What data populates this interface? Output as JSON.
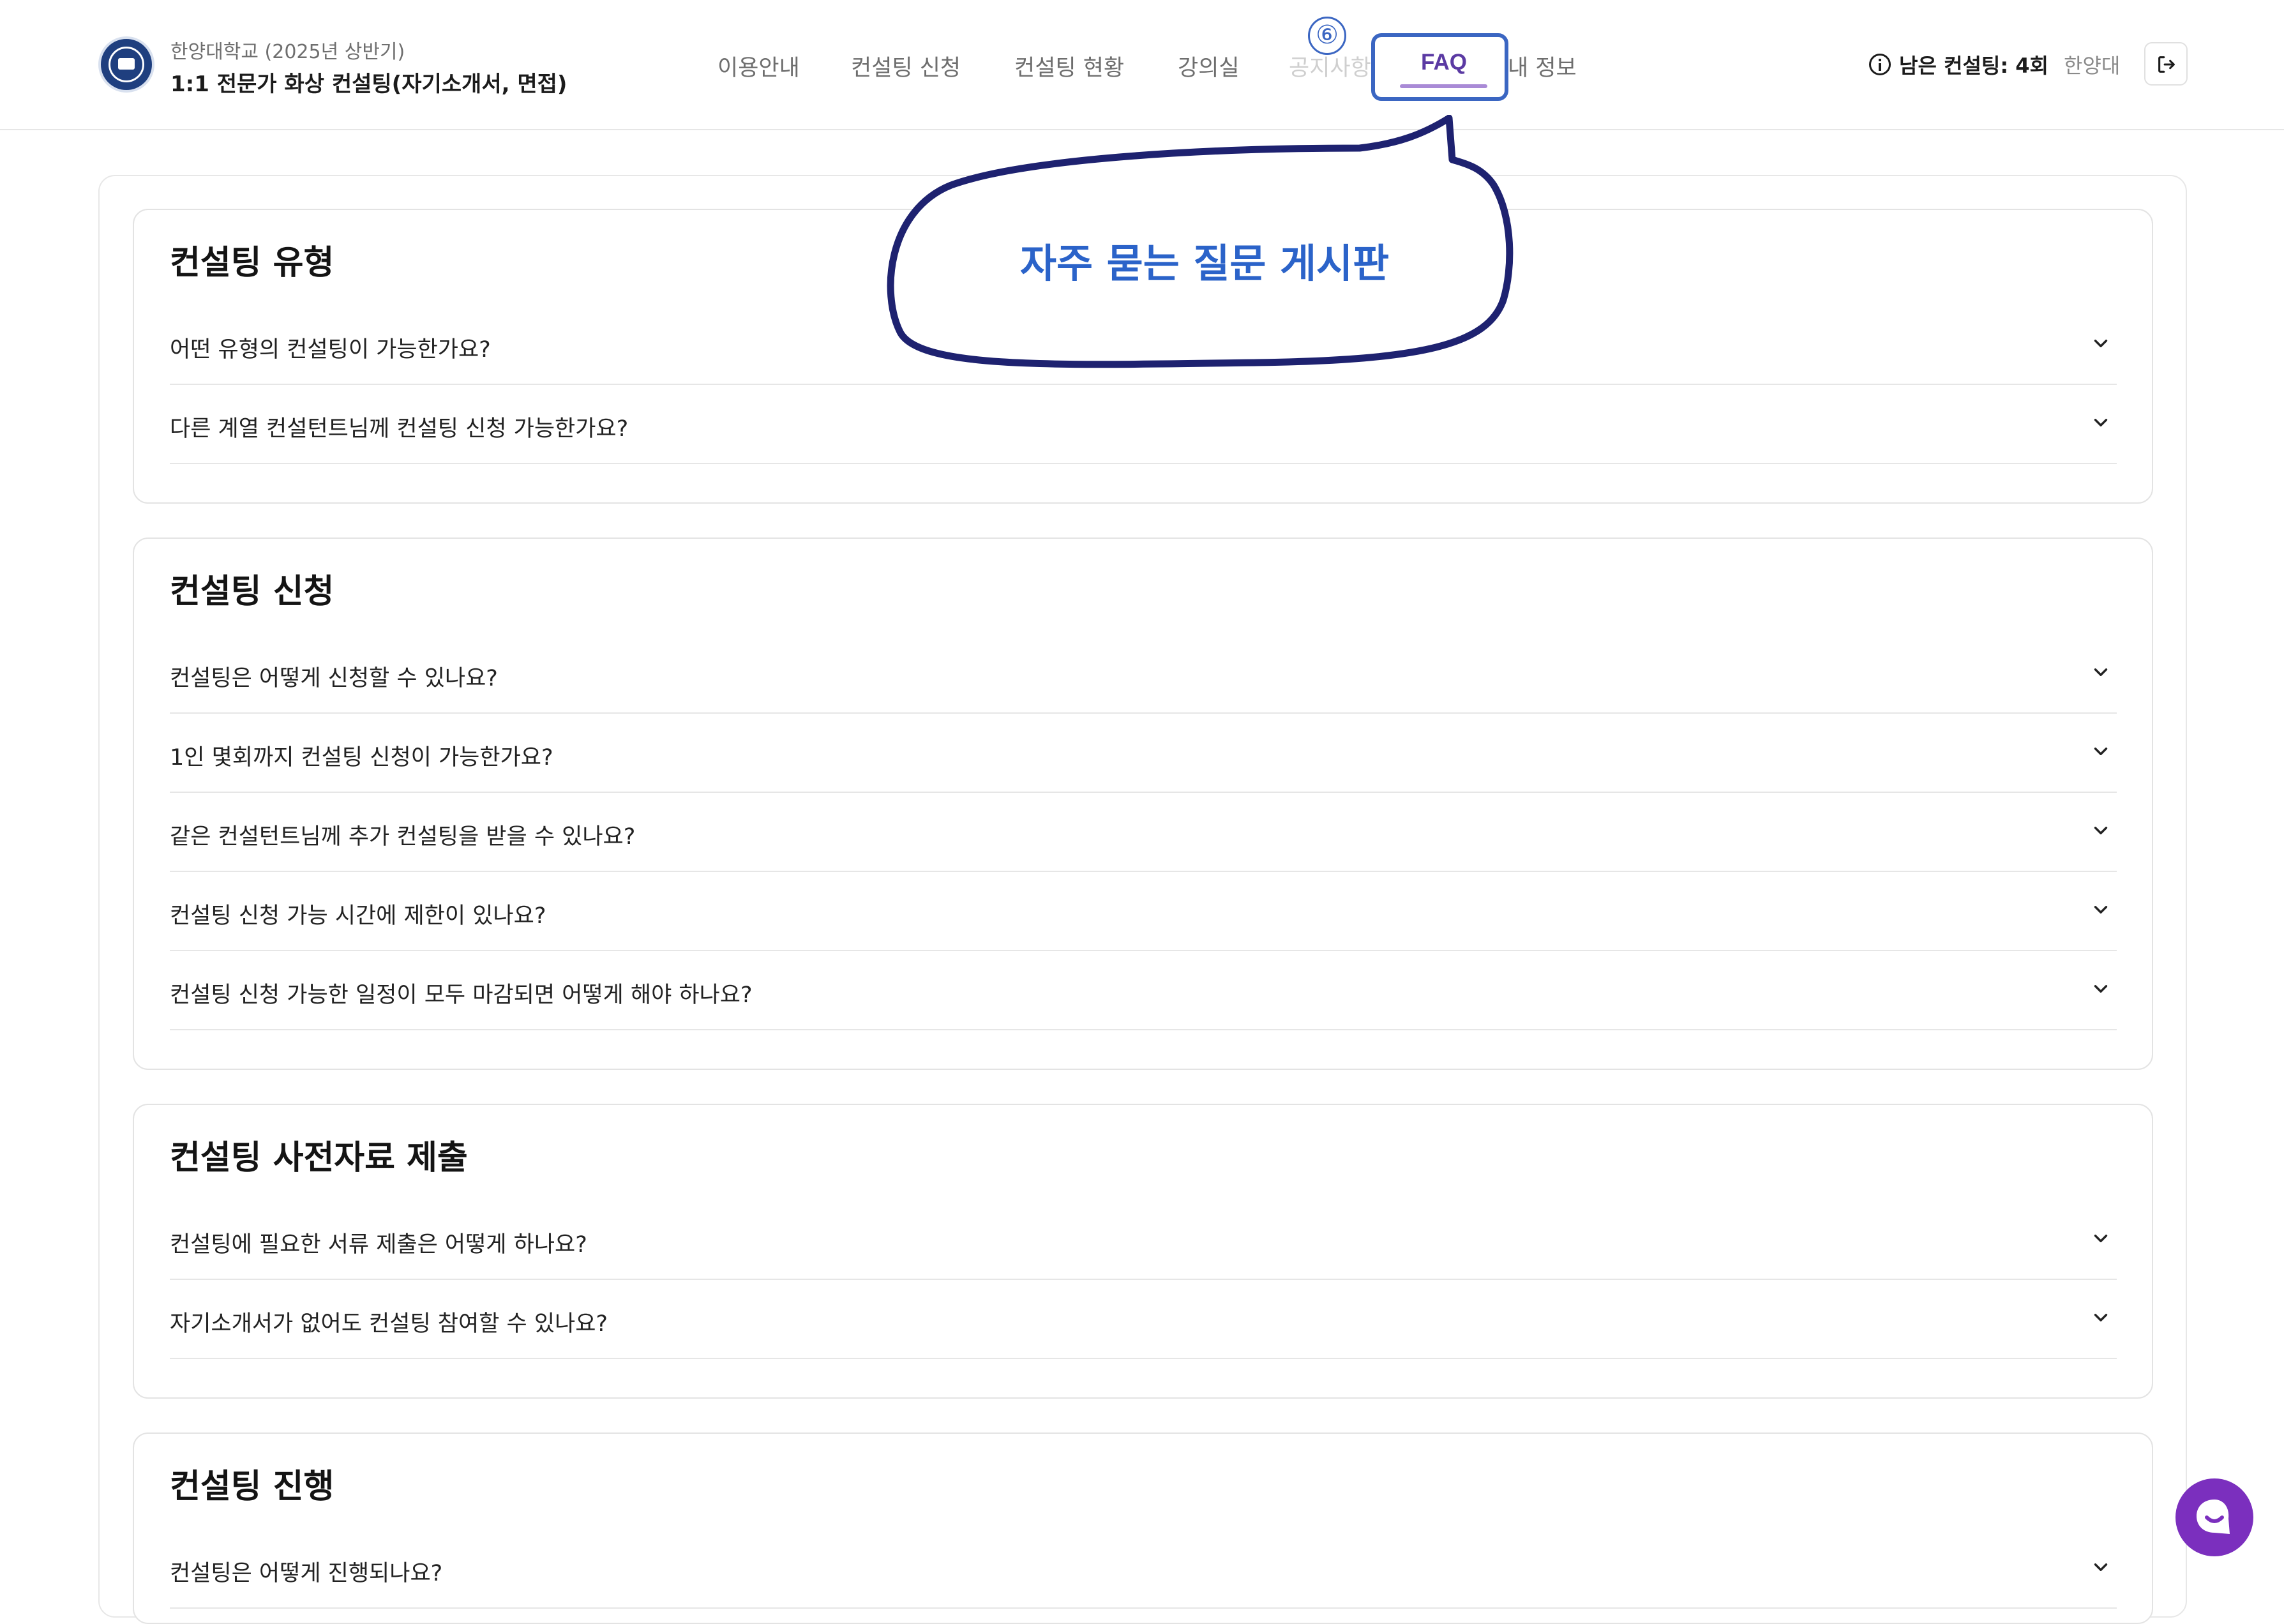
{
  "header": {
    "subtitle": "한양대학교 (2025년 상반기)",
    "title": "1:1 전문가 화상 컨설팅(자기소개서, 면접)",
    "nav": [
      {
        "label": "이용안내"
      },
      {
        "label": "컨설팅 신청"
      },
      {
        "label": "컨설팅 현황"
      },
      {
        "label": "강의실"
      },
      {
        "label": "공지사항"
      },
      {
        "label": "FAQ"
      },
      {
        "label": "내 정보"
      }
    ],
    "remaining": "남은 컨설팅: 4회",
    "university": "한양대"
  },
  "annotation": {
    "step_number": "⑥",
    "callout_text": "자주 묻는 질문 게시판"
  },
  "sections": [
    {
      "title": "컨설팅 유형",
      "questions": [
        "어떤 유형의 컨설팅이 가능한가요?",
        "다른 계열 컨설턴트님께 컨설팅 신청 가능한가요?"
      ]
    },
    {
      "title": "컨설팅 신청",
      "questions": [
        "컨설팅은 어떻게 신청할 수 있나요?",
        "1인 몇회까지 컨설팅 신청이 가능한가요?",
        "같은 컨설턴트님께 추가 컨설팅을 받을 수 있나요?",
        "컨설팅 신청 가능 시간에 제한이 있나요?",
        "컨설팅 신청 가능한 일정이 모두 마감되면 어떻게 해야 하나요?"
      ]
    },
    {
      "title": "컨설팅 사전자료 제출",
      "questions": [
        "컨설팅에 필요한 서류 제출은 어떻게 하나요?",
        "자기소개서가 없어도 컨설팅 참여할 수 있나요?"
      ]
    },
    {
      "title": "컨설팅 진행",
      "questions": [
        "컨설팅은 어떻게 진행되나요?"
      ]
    }
  ],
  "colors": {
    "accent": "#5b3aa3",
    "annotation": "#3b66c2",
    "callout_border": "#1e2270",
    "chat": "#7b2fbe"
  }
}
